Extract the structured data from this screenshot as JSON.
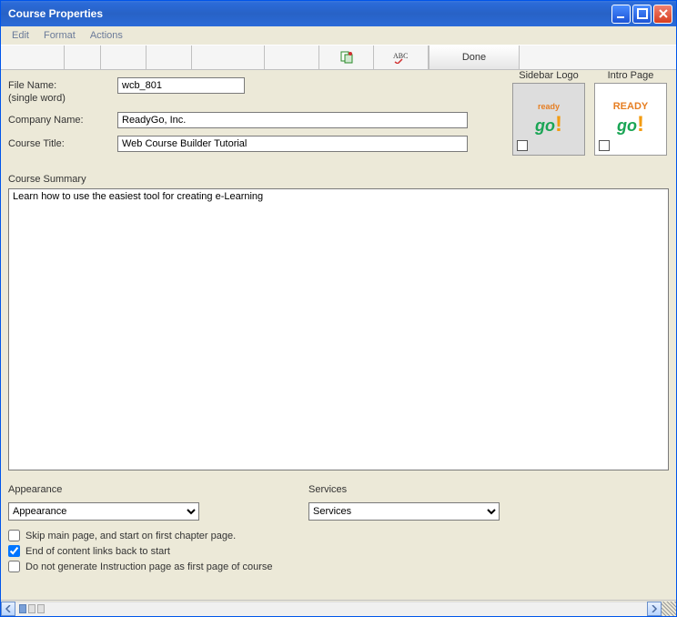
{
  "window": {
    "title": "Course Properties"
  },
  "menu": {
    "edit": "Edit",
    "format": "Format",
    "actions": "Actions"
  },
  "toolbar": {
    "done": "Done"
  },
  "fields": {
    "file_name_label": "File Name:",
    "file_name_sub": "(single word)",
    "file_name_value": "wcb_801",
    "company_label": "Company Name:",
    "company_value": "ReadyGo, Inc.",
    "title_label": "Course Title:",
    "title_value": "Web Course Builder Tutorial"
  },
  "logos": {
    "sidebar_label": "Sidebar Logo",
    "intro_label": "Intro Page"
  },
  "summary": {
    "label": "Course Summary",
    "value": "Learn how to use the easiest tool for creating e-Learning"
  },
  "bottom": {
    "appearance_label": "Appearance",
    "appearance_value": "Appearance",
    "services_label": "Services",
    "services_value": "Services"
  },
  "checks": {
    "skip": "Skip main page, and start on first chapter page.",
    "endlink": "End of content links back to start",
    "noinstr": "Do not generate Instruction page as first page of course"
  }
}
